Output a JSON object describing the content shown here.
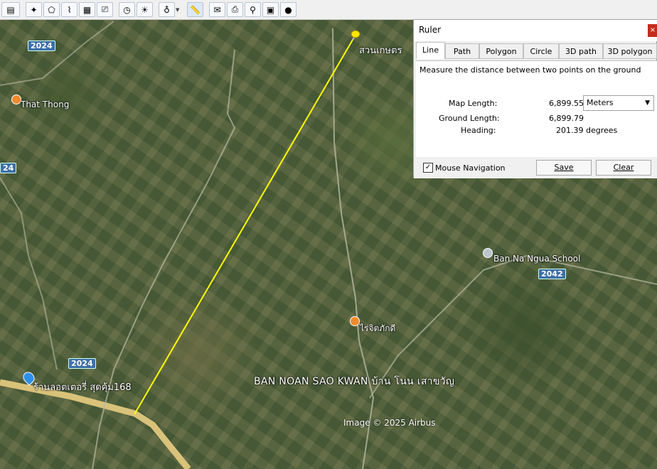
{
  "toolbar": {
    "buttons": [
      {
        "icon": "sidebar-toggle-icon"
      },
      {
        "icon": "placemark-icon"
      },
      {
        "icon": "polygon-icon"
      },
      {
        "icon": "path-icon"
      },
      {
        "icon": "overlay-icon"
      },
      {
        "icon": "tour-icon"
      },
      {
        "icon": "historical-imagery-icon"
      },
      {
        "icon": "sunlight-icon"
      },
      {
        "icon": "planets-icon"
      },
      {
        "icon": "ruler-icon"
      },
      {
        "icon": "email-icon"
      },
      {
        "icon": "print-icon"
      },
      {
        "icon": "google-maps-icon"
      },
      {
        "icon": "save-image-icon"
      },
      {
        "icon": "globe-icon"
      }
    ]
  },
  "map": {
    "labels": {
      "top_place": "สวนเกษตร",
      "that_thong": "That Thong",
      "school": "Ban Na Ngua School",
      "rai": "ไร่จิตภักดี",
      "shop": "ร้านลอตเตอรี่ สุดคุ้ม168",
      "region": "BAN NOAN SAO KWAN บ้าน โนน เสาขวัญ",
      "copyright": "Image © 2025 Airbus"
    },
    "roads": {
      "r1": "2024",
      "r2": "24",
      "r3": "2024",
      "r4": "2042"
    },
    "colors": {
      "measure_line": "#ffff00",
      "road": "#d9c27a"
    }
  },
  "ruler": {
    "title": "Ruler",
    "close": "×",
    "tabs": [
      "Line",
      "Path",
      "Polygon",
      "Circle",
      "3D path",
      "3D polygon"
    ],
    "active_tab": "Line",
    "description": "Measure the distance between two points on the ground",
    "map_length_label": "Map Length:",
    "map_length_value": "6,899.55",
    "units": "Meters",
    "ground_length_label": "Ground Length:",
    "ground_length_value": "6,899.79",
    "heading_label": "Heading:",
    "heading_value": "201.39 degrees",
    "mouse_nav_label": "Mouse Navigation",
    "mouse_nav_checked": "✓",
    "save_label": "Save",
    "clear_label": "Clear"
  }
}
